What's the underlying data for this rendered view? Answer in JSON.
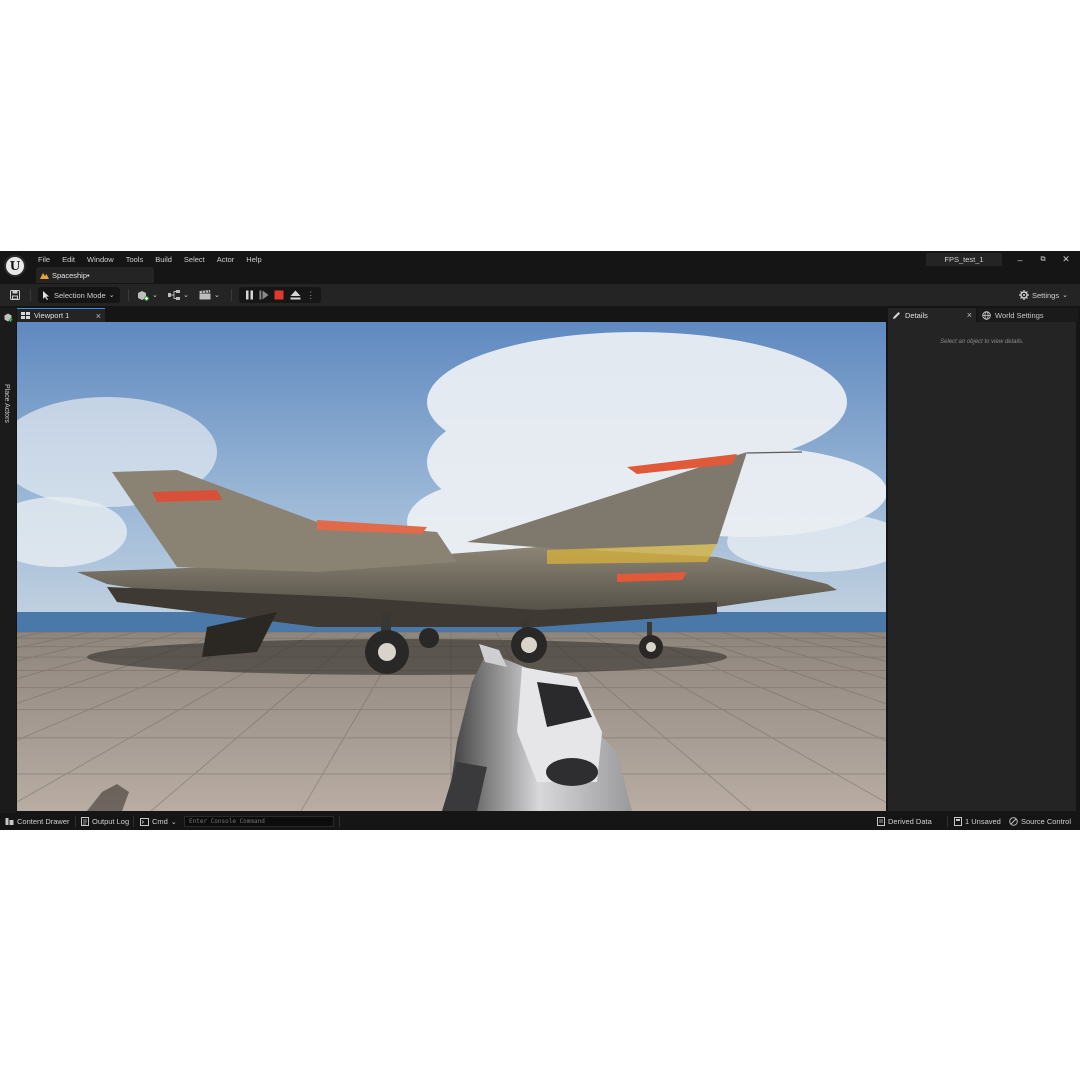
{
  "menu": {
    "items": [
      "File",
      "Edit",
      "Window",
      "Tools",
      "Build",
      "Select",
      "Actor",
      "Help"
    ]
  },
  "level_tab": {
    "label": "Spaceship•"
  },
  "window": {
    "project_name": "FPS_test_1",
    "minimize": "–",
    "restore": "⧉",
    "close": "✕"
  },
  "toolbar": {
    "selection_mode_label": "Selection Mode",
    "settings_label": "Settings"
  },
  "left_strip": {
    "place_actors_label": "Place Actors"
  },
  "viewport": {
    "tab_label": "Viewport 1",
    "close": "×"
  },
  "details": {
    "tab_label": "Details",
    "close": "×",
    "world_settings_label": "World Settings",
    "empty_message": "Select an object to view details."
  },
  "statusbar": {
    "content_drawer": "Content Drawer",
    "output_log": "Output Log",
    "cmd": "Cmd",
    "console_placeholder": "Enter Console Command",
    "derived_data": "Derived Data",
    "unsaved": "1 Unsaved",
    "source_control": "Source Control"
  },
  "colors": {
    "editor_bg": "#151515",
    "panel_bg": "#242424",
    "stop_red": "#e03a2f",
    "accent_blue": "#3c8de0"
  }
}
